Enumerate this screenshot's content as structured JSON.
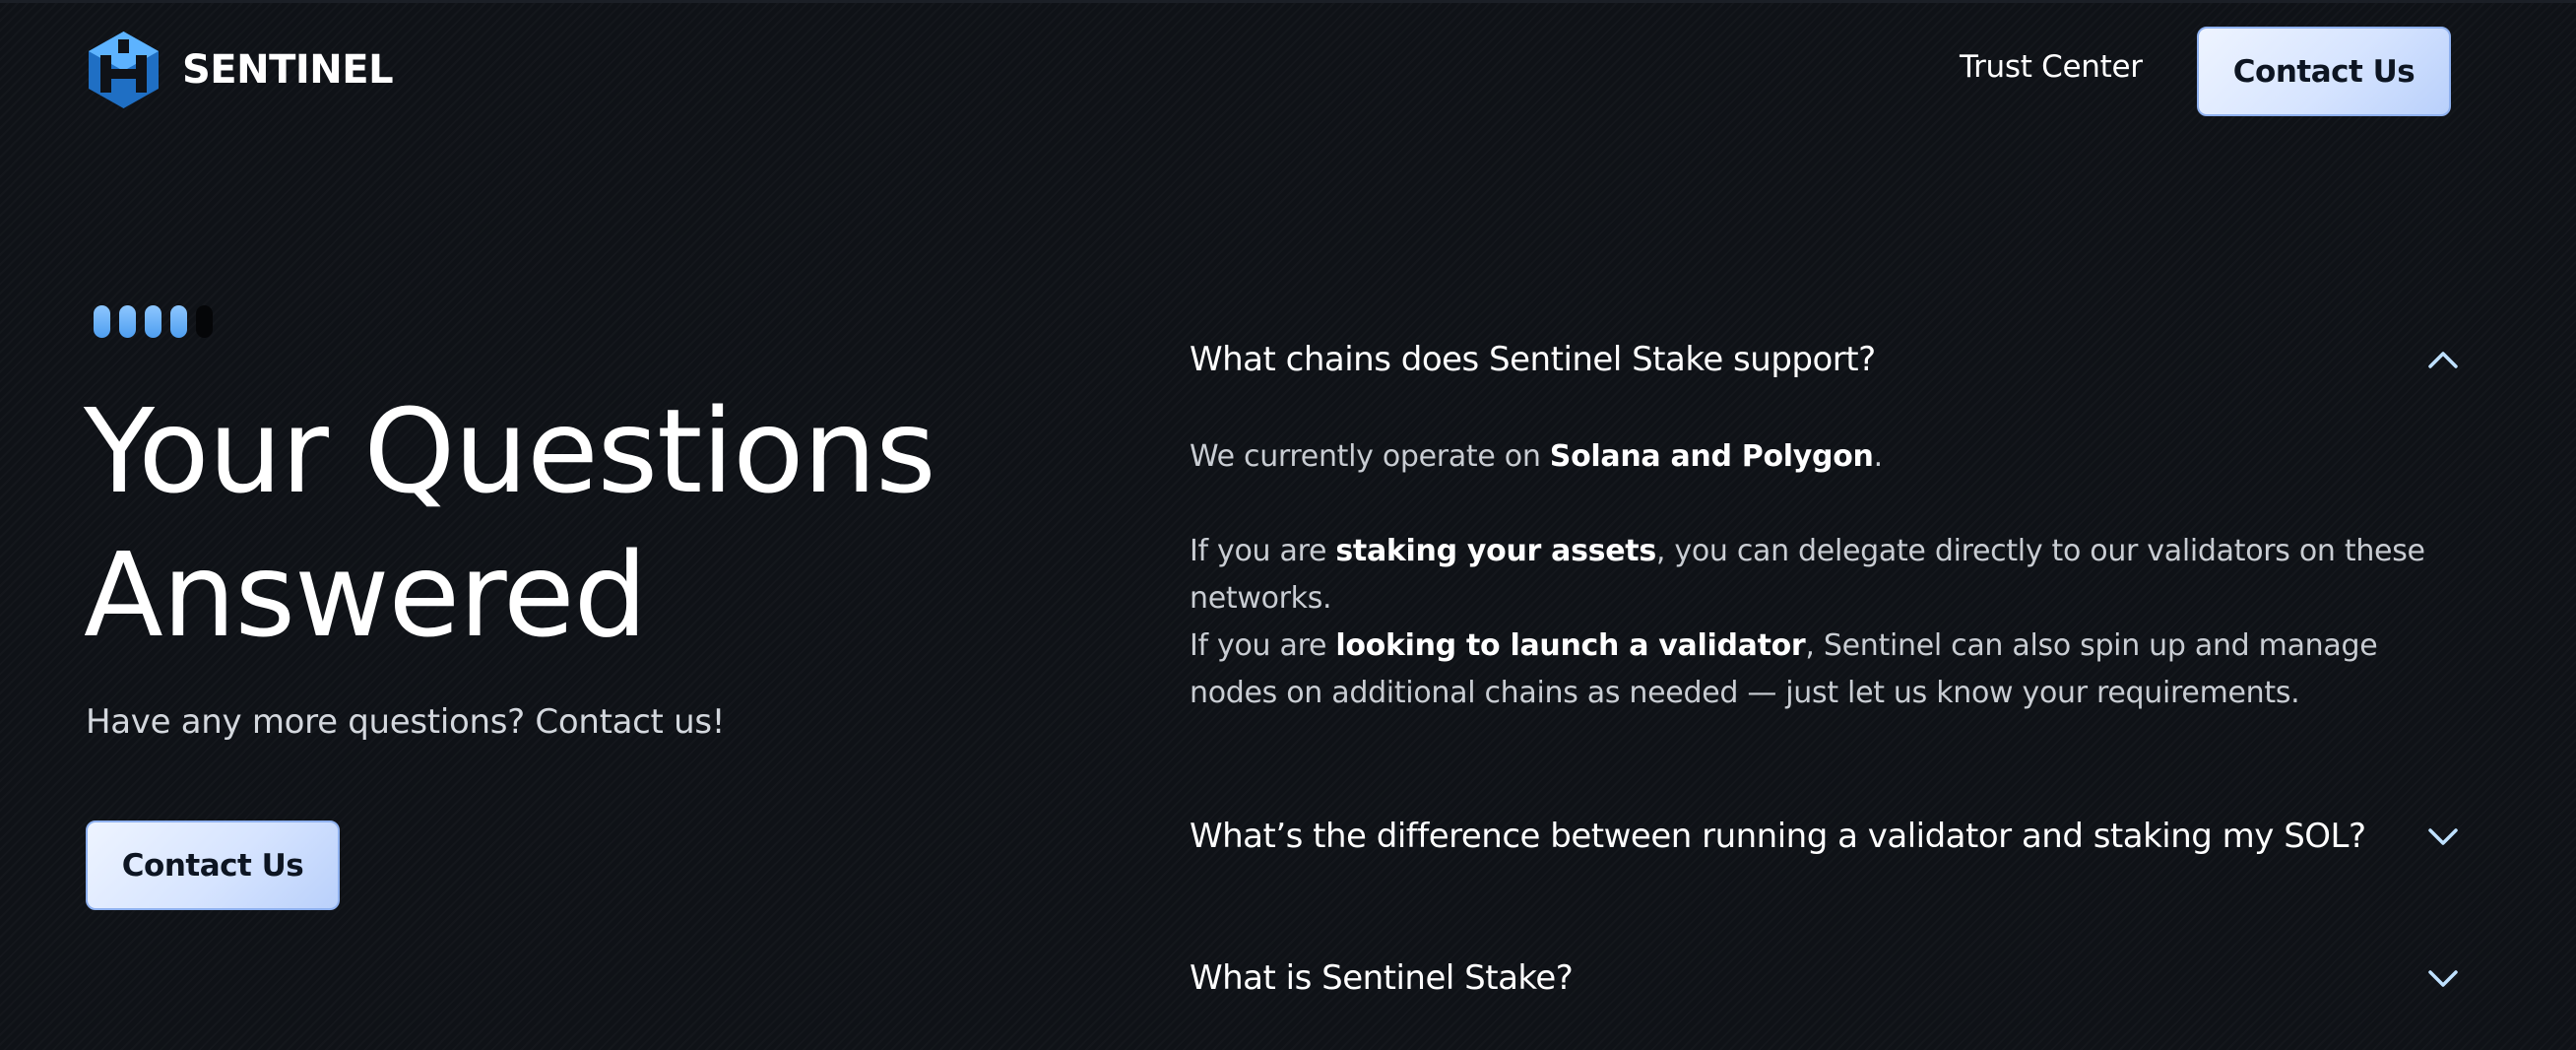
{
  "header": {
    "brand": "SENTINEL",
    "nav_trust_center": "Trust Center",
    "contact_label": "Contact Us"
  },
  "hero": {
    "title_line1": "Your Questions",
    "title_line2": "Answered",
    "subtitle": "Have any more questions? Contact us!",
    "contact_label": "Contact Us"
  },
  "faq": {
    "items": [
      {
        "question": "What chains does Sentinel Stake support?",
        "expanded": true,
        "answer": {
          "p1_prefix": "We currently operate on ",
          "p1_bold": "Solana and Polygon",
          "p1_suffix": ".",
          "p2_prefix": "If you are ",
          "p2_bold": "staking your assets",
          "p2_suffix": ", you can delegate directly to our validators on these networks.",
          "p3_prefix": "If you are ",
          "p3_bold": "looking to launch a validator",
          "p3_suffix": ", Sentinel can also spin up and manage nodes on additional chains as needed — just let us know your requirements."
        }
      },
      {
        "question": "What’s the difference between running a validator and staking my SOL?",
        "expanded": false
      },
      {
        "question": "What is Sentinel Stake?",
        "expanded": false
      }
    ]
  },
  "colors": {
    "background": "#0f1217",
    "accent_button": "#d6e4ff",
    "chevron": "#bfe1ff",
    "logo_blue": "#3d9cf0"
  },
  "icons": {
    "logo": "sentinel-logo-icon",
    "expanded": "chevron-up-icon",
    "collapsed": "chevron-down-icon"
  }
}
